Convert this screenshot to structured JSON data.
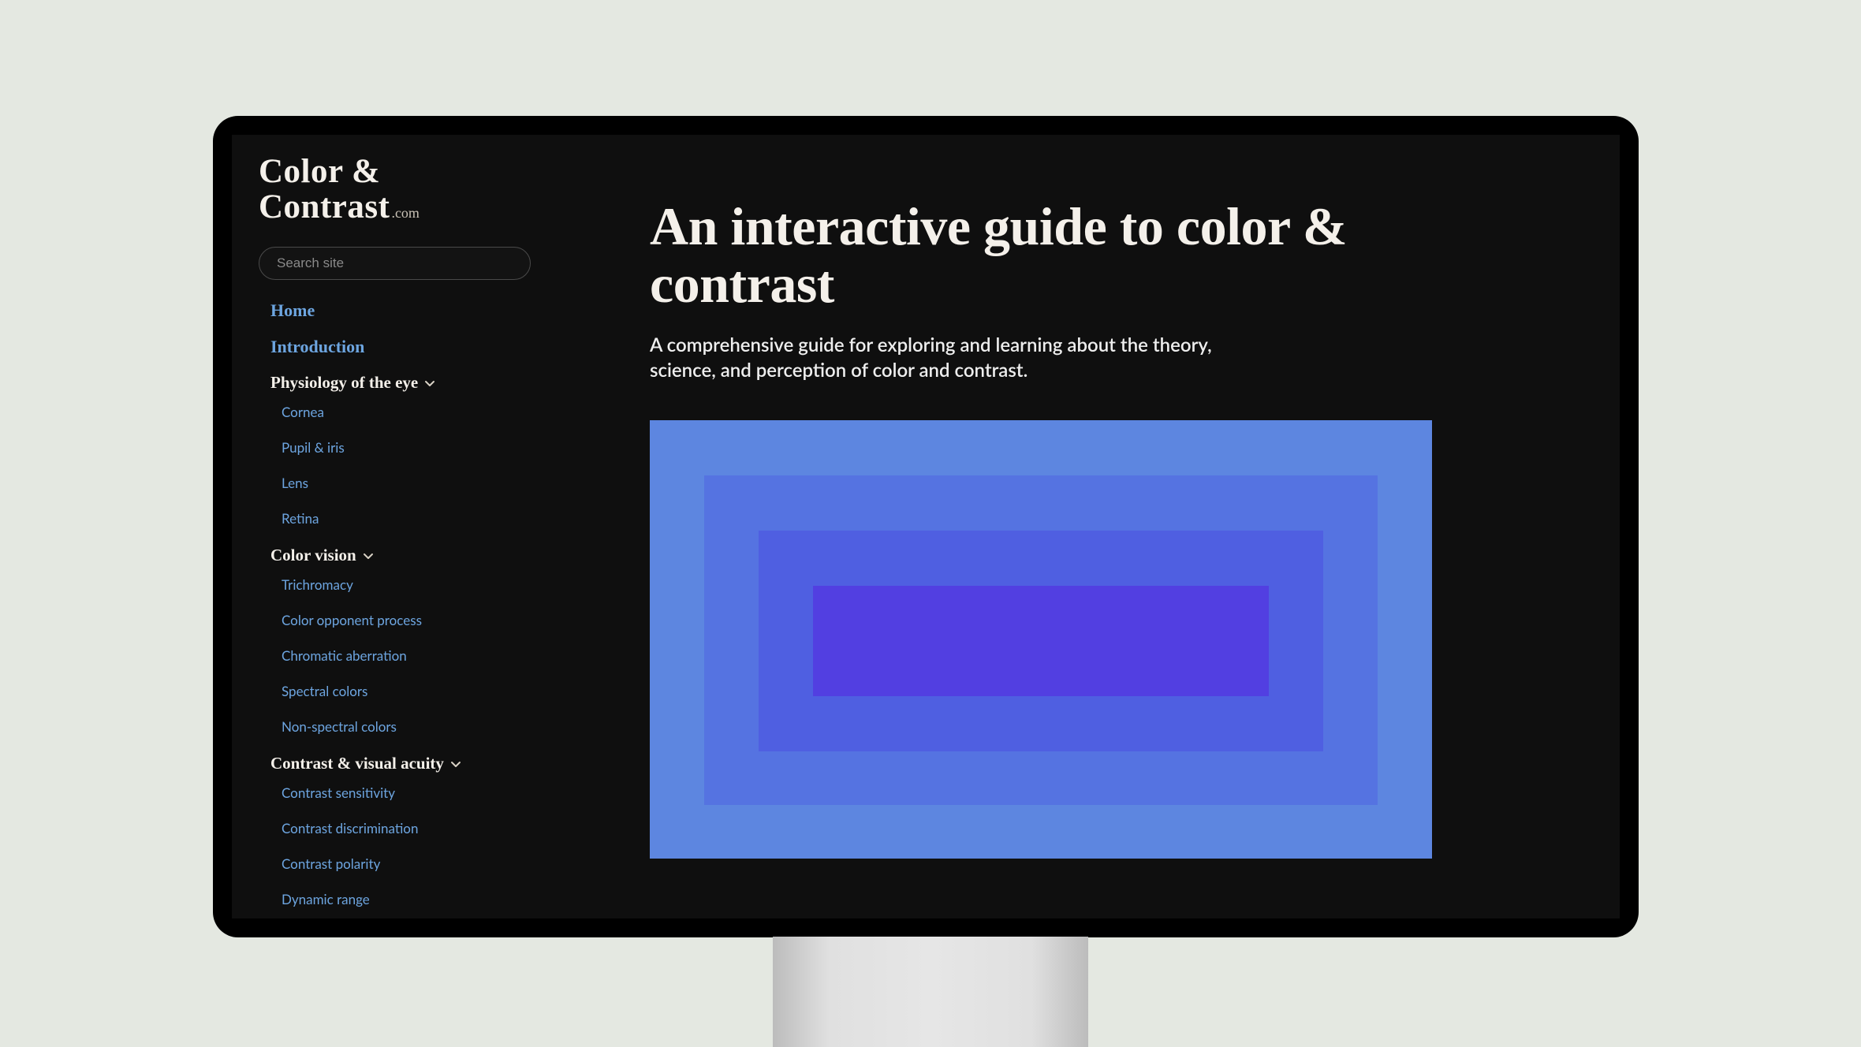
{
  "logo": {
    "line1": "Color &",
    "line2": "Contrast",
    "tld": ".com"
  },
  "search": {
    "placeholder": "Search site"
  },
  "nav": {
    "home": "Home",
    "intro": "Introduction",
    "sections": [
      {
        "title": "Physiology of the eye",
        "items": [
          "Cornea",
          "Pupil & iris",
          "Lens",
          "Retina"
        ]
      },
      {
        "title": "Color vision",
        "items": [
          "Trichromacy",
          "Color opponent process",
          "Chromatic aberration",
          "Spectral colors",
          "Non-spectral colors"
        ]
      },
      {
        "title": "Contrast & visual acuity",
        "items": [
          "Contrast sensitivity",
          "Contrast discrimination",
          "Contrast polarity",
          "Dynamic range"
        ]
      }
    ]
  },
  "main": {
    "headline": "An interactive guide to color & contrast",
    "subtitle": "A comprehensive guide for exploring and learning about the theory, science, and perception of color and contrast."
  },
  "illustration": {
    "colors": [
      "#5d86e0",
      "#5573e1",
      "#4f5fe1",
      "#523fe1"
    ]
  }
}
